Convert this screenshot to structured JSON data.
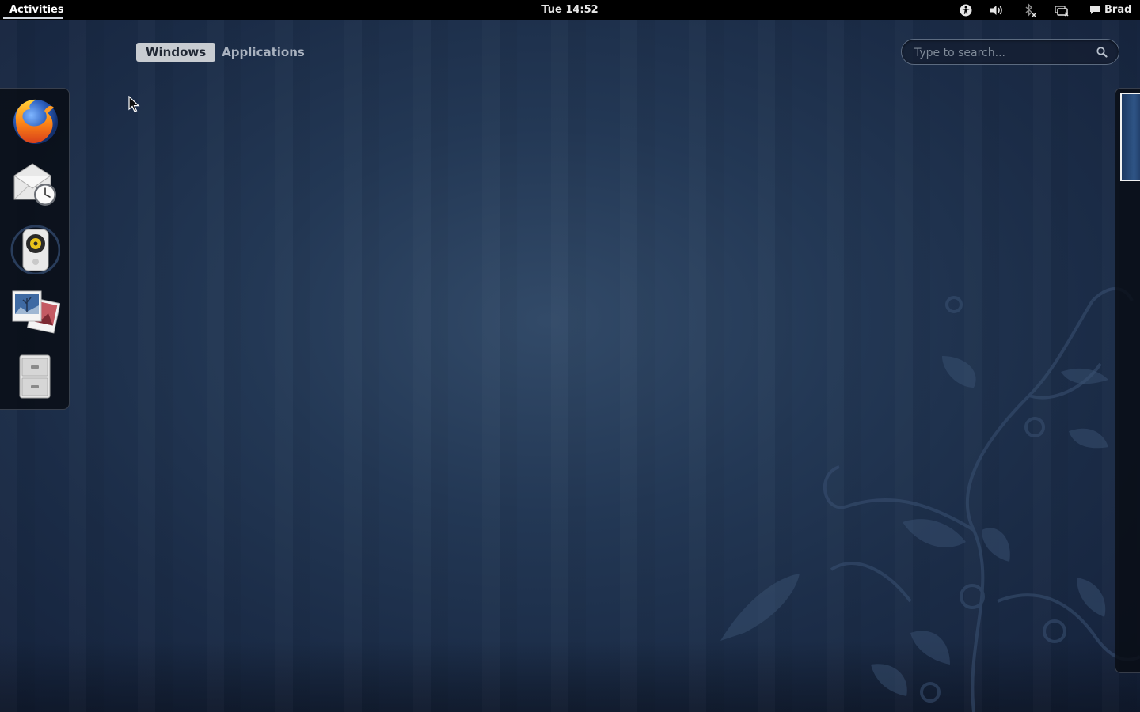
{
  "topbar": {
    "activities_label": "Activities",
    "clock": "Tue 14:52",
    "tray_icons": [
      "accessibility-icon",
      "volume-icon",
      "bluetooth-icon",
      "display-icon",
      "chat-icon"
    ],
    "user_name": "Brad"
  },
  "overview": {
    "tabs": [
      {
        "label": "Windows",
        "active": true
      },
      {
        "label": "Applications",
        "active": false
      }
    ],
    "search": {
      "placeholder": "Type to search..."
    }
  },
  "dash": {
    "apps": [
      {
        "name": "Firefox",
        "icon": "firefox-icon"
      },
      {
        "name": "Evolution",
        "icon": "mail-clock-icon"
      },
      {
        "name": "Rhythmbox",
        "icon": "speaker-icon"
      },
      {
        "name": "Shotwell",
        "icon": "photos-icon"
      },
      {
        "name": "Files",
        "icon": "file-cabinet-icon"
      }
    ]
  },
  "colors": {
    "background": "#1c2d47",
    "topbar": "#000000",
    "active_tab": "#c8ccd1"
  }
}
